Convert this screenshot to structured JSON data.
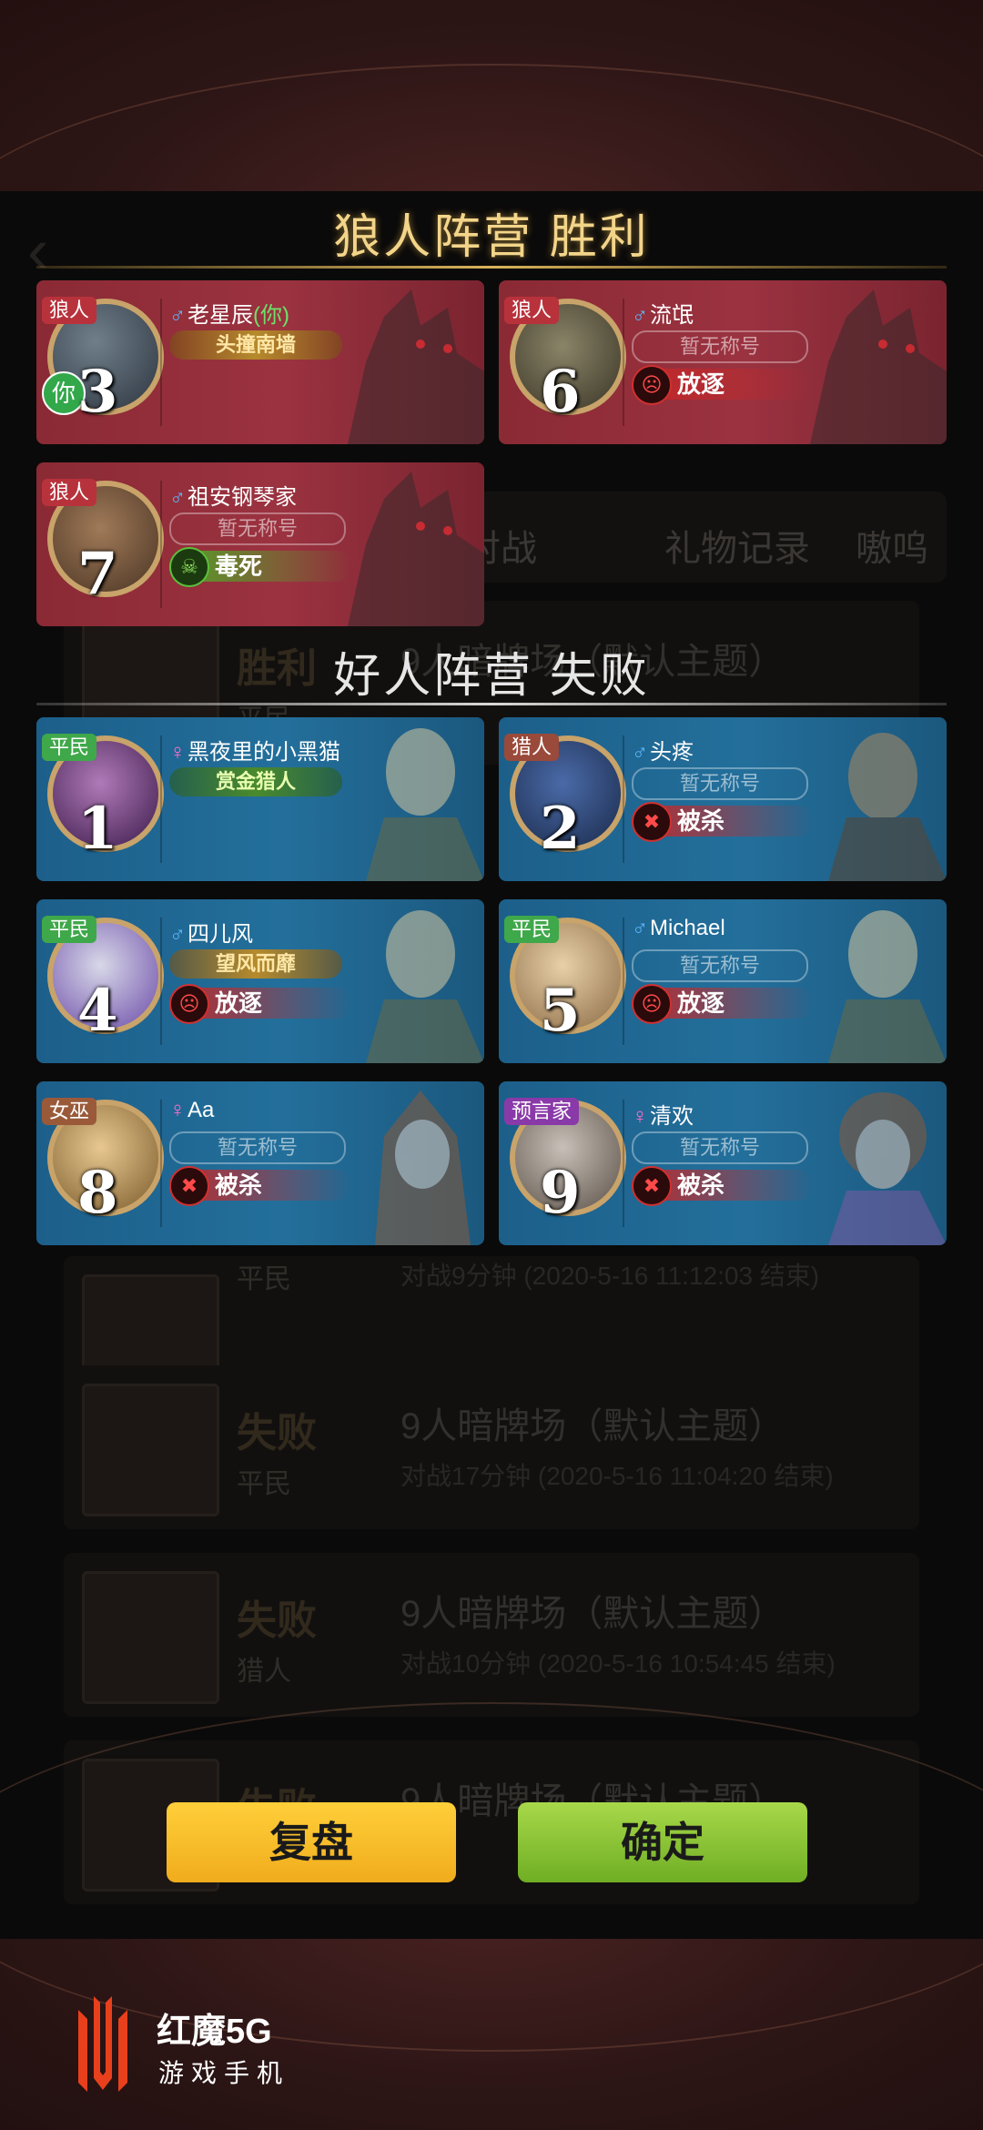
{
  "background_list": {
    "tabs": [
      "对战",
      "礼物记录",
      "嗷呜"
    ],
    "rows": [
      {
        "result": "胜利",
        "role": "平民",
        "title": "9人暗牌场（默认主题）",
        "sub": ""
      },
      {
        "result": "",
        "role": "平民",
        "title": "",
        "sub": "对战9分钟 (2020-5-16 11:12:03 结束)"
      },
      {
        "result": "失败",
        "role": "平民",
        "title": "9人暗牌场（默认主题）",
        "sub": "对战17分钟 (2020-5-16 11:04:20 结束)"
      },
      {
        "result": "失败",
        "role": "猎人",
        "title": "9人暗牌场（默认主题）",
        "sub": "对战10分钟 (2020-5-16 10:54:45 结束)"
      },
      {
        "result": "失败",
        "role": "",
        "title": "9人暗牌场（默认主题）",
        "sub": ""
      }
    ]
  },
  "wolf_camp": {
    "title": "狼人阵营  胜利",
    "players": [
      {
        "number": "3",
        "role": "狼人",
        "sex": "♂",
        "name": "老星辰",
        "you": "(你)",
        "you_badge": "你",
        "badge": "头撞南墙",
        "badge_type": "title",
        "fate": ""
      },
      {
        "number": "6",
        "role": "狼人",
        "sex": "♂",
        "name": "流氓",
        "you": "",
        "badge": "暂无称号",
        "badge_type": "none",
        "fate": "放逐"
      },
      {
        "number": "7",
        "role": "狼人",
        "sex": "♂",
        "name": "祖安钢琴家",
        "you": "",
        "badge": "暂无称号",
        "badge_type": "none",
        "fate": "毒死"
      }
    ]
  },
  "good_camp": {
    "title": "好人阵营  失败",
    "players": [
      {
        "number": "1",
        "role": "平民",
        "sex": "♀",
        "name": "黑夜里的小黑猫",
        "badge": "赏金猎人",
        "badge_type": "title",
        "fate": ""
      },
      {
        "number": "2",
        "role": "猎人",
        "sex": "♂",
        "name": "头疼",
        "badge": "暂无称号",
        "badge_type": "none",
        "fate": "被杀"
      },
      {
        "number": "4",
        "role": "平民",
        "sex": "♂",
        "name": "四儿风",
        "badge": "望风而靡",
        "badge_type": "title",
        "fate": "放逐"
      },
      {
        "number": "5",
        "role": "平民",
        "sex": "♂",
        "name": "Michael",
        "badge": "暂无称号",
        "badge_type": "none",
        "fate": "放逐"
      },
      {
        "number": "8",
        "role": "女巫",
        "sex": "♀",
        "name": "Aa",
        "badge": "暂无称号",
        "badge_type": "none",
        "fate": "被杀"
      },
      {
        "number": "9",
        "role": "预言家",
        "sex": "♀",
        "name": "清欢",
        "badge": "暂无称号",
        "badge_type": "none",
        "fate": "被杀"
      }
    ]
  },
  "buttons": {
    "replay": "复盘",
    "confirm": "确定"
  },
  "brand": {
    "name": "红魔5G",
    "sub": "游戏手机"
  },
  "colors": {
    "wolf_card": "#9b3240",
    "good_card": "#236f9b",
    "title_gold": "#f3d58a",
    "replay_btn": "#ffcf3a",
    "confirm_btn": "#8cc83a"
  }
}
